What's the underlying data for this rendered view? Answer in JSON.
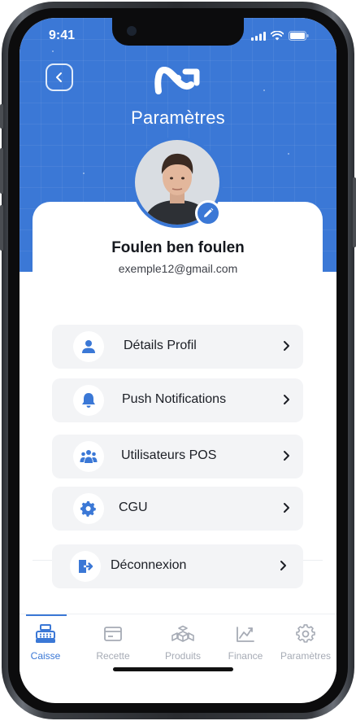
{
  "status_bar": {
    "time": "9:41"
  },
  "header": {
    "title": "Paramètres"
  },
  "profile": {
    "name": "Foulen ben foulen",
    "email": "exemple12@gmail.com"
  },
  "menu": [
    {
      "label": "Détails Profil",
      "icon": "user-icon"
    },
    {
      "label": "Push Notifications",
      "icon": "bell-icon"
    },
    {
      "label": "Utilisateurs POS",
      "icon": "users-icon"
    },
    {
      "label": "CGU",
      "icon": "gear-icon"
    },
    {
      "label": "Déconnexion",
      "icon": "logout-icon"
    }
  ],
  "tabs": [
    {
      "label": "Caisse",
      "icon": "cash-register-icon",
      "active": true
    },
    {
      "label": "Recette",
      "icon": "card-icon",
      "active": false
    },
    {
      "label": "Produits",
      "icon": "boxes-icon",
      "active": false
    },
    {
      "label": "Finance",
      "icon": "chart-icon",
      "active": false
    },
    {
      "label": "Paramètres",
      "icon": "settings-icon",
      "active": false
    }
  ],
  "colors": {
    "primary": "#3b78d6",
    "tab_inactive": "#a6abb5",
    "menu_bg": "#f3f4f6"
  }
}
